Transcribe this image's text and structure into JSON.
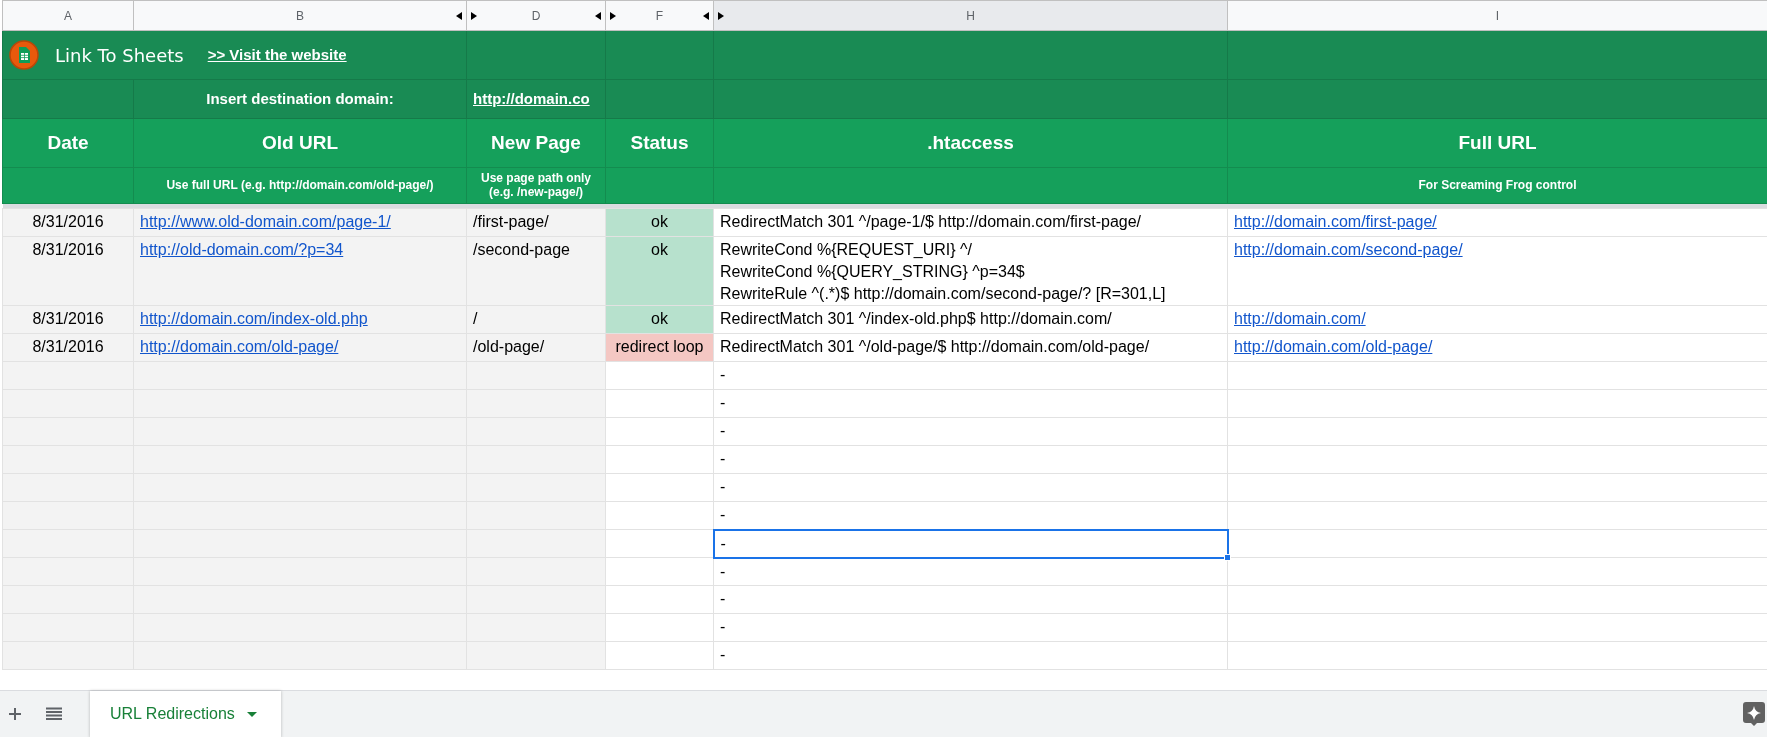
{
  "column_headers": [
    {
      "label": "A",
      "selected": false,
      "collapsed_left": false,
      "collapsed_right": false
    },
    {
      "label": "B",
      "selected": false,
      "collapsed_left": false,
      "collapsed_right": true
    },
    {
      "label": "D",
      "selected": false,
      "collapsed_left": true,
      "collapsed_right": true
    },
    {
      "label": "F",
      "selected": false,
      "collapsed_left": true,
      "collapsed_right": true
    },
    {
      "label": "H",
      "selected": true,
      "collapsed_left": true,
      "collapsed_right": false
    },
    {
      "label": "I",
      "selected": false,
      "collapsed_left": false,
      "collapsed_right": false
    }
  ],
  "brand": {
    "name": "Link To Sheets",
    "link": ">> Visit the website"
  },
  "domain_row": {
    "label": "Insert destination domain:",
    "value": "http://domain.co"
  },
  "headers": [
    {
      "title": "Date"
    },
    {
      "title": "Old URL",
      "hint": "Use full URL (e.g. http://domain.com/old-page/)"
    },
    {
      "title": "New Page",
      "hint": "Use page path only (e.g. /new-page/)"
    },
    {
      "title": "Status"
    },
    {
      "title": ".htaccess"
    },
    {
      "title": "Full URL",
      "hint": "For Screaming Frog control"
    }
  ],
  "rows": [
    {
      "date": "8/31/2016",
      "old_url": "http://www.old-domain.com/page-1/",
      "new_page": "/first-page/",
      "status": "ok",
      "color": "#b7e1cd",
      "htaccess": [
        "RedirectMatch 301 ^/page-1/$ http://domain.com/first-page/"
      ],
      "full_url": "http://domain.com/first-page/"
    },
    {
      "date": "8/31/2016",
      "old_url": "http://old-domain.com/?p=34",
      "new_page": "/second-page",
      "status": "ok",
      "color": "#b7e1cd",
      "htaccess": [
        "RewriteCond %{REQUEST_URI} ^/",
        "RewriteCond %{QUERY_STRING} ^p=34$",
        "RewriteRule ^(.*)$ http://domain.com/second-page/? [R=301,L]"
      ],
      "full_url": "http://domain.com/second-page/"
    },
    {
      "date": "8/31/2016",
      "old_url": "http://domain.com/index-old.php",
      "new_page": "/",
      "status": "ok",
      "color": "#b7e1cd",
      "htaccess": [
        "RedirectMatch 301 ^/index-old.php$ http://domain.com/"
      ],
      "full_url": "http://domain.com/"
    },
    {
      "date": "8/31/2016",
      "old_url": "http://domain.com/old-page/",
      "new_page": "/old-page/",
      "status": "redirect loop",
      "color": "#f4c7c3",
      "htaccess": [
        "RedirectMatch 301 ^/old-page/$ http://domain.com/old-page/"
      ],
      "full_url": "http://domain.com/old-page/"
    }
  ],
  "empty_rows": [
    {
      "htaccess": "-",
      "selected": false
    },
    {
      "htaccess": "-",
      "selected": false
    },
    {
      "htaccess": "-",
      "selected": false
    },
    {
      "htaccess": "-",
      "selected": false
    },
    {
      "htaccess": "-",
      "selected": false
    },
    {
      "htaccess": "-",
      "selected": false
    },
    {
      "htaccess": "-",
      "selected": true
    },
    {
      "htaccess": "-",
      "selected": false
    },
    {
      "htaccess": "-",
      "selected": false
    },
    {
      "htaccess": "-",
      "selected": false
    },
    {
      "htaccess": "-",
      "selected": false
    }
  ],
  "sheet_tabs": [
    {
      "label": "URL Redirections",
      "selected": true
    }
  ]
}
